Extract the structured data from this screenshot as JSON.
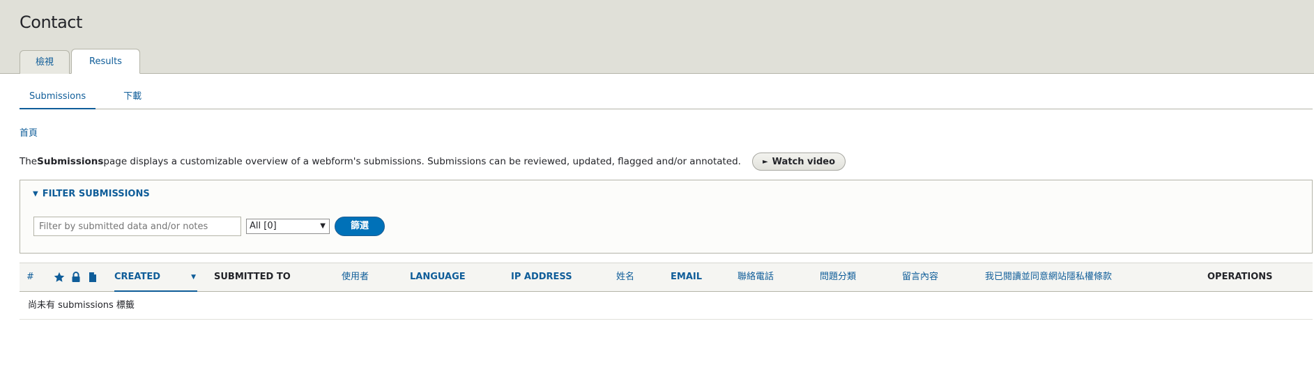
{
  "header": {
    "title": "Contact",
    "tabs": [
      {
        "label": "檢視",
        "active": false
      },
      {
        "label": "Results",
        "active": true
      }
    ]
  },
  "subtabs": [
    {
      "label": "Submissions",
      "active": true
    },
    {
      "label": "下載",
      "active": false
    }
  ],
  "breadcrumb": "首頁",
  "description": {
    "prefix": "The ",
    "bold": "Submissions",
    "suffix": " page displays a customizable overview of a webform's submissions. Submissions can be reviewed, updated, flagged and/or annotated.",
    "video_button": "Watch video",
    "video_icon": "play-icon"
  },
  "filter": {
    "summary": "FILTER SUBMISSIONS",
    "placeholder": "Filter by submitted data and/or notes",
    "value": "",
    "select_value": "All [0]",
    "submit": "篩選"
  },
  "table": {
    "columns": {
      "number": "#",
      "created": "CREATED",
      "submitted_to": "SUBMITTED TO",
      "user": "使用者",
      "language": "LANGUAGE",
      "ip": "IP ADDRESS",
      "name": "姓名",
      "email": "EMAIL",
      "phone": "聯絡電話",
      "category": "問題分類",
      "message": "留言內容",
      "privacy": "我已閱讀並同意網站隱私權條款",
      "operations": "OPERATIONS"
    },
    "icons": [
      "star-icon",
      "lock-icon",
      "file-icon"
    ],
    "empty_message": "尚未有 submissions 標籤"
  },
  "colors": {
    "link": "#0f5d99",
    "header_bg": "#e0e0d8",
    "button_blue": "#0071b8"
  }
}
